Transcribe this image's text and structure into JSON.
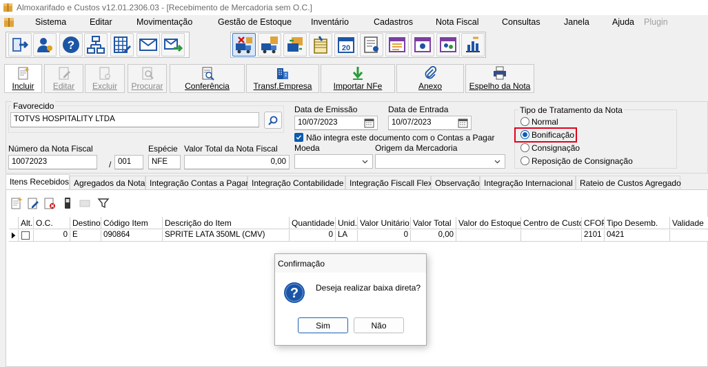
{
  "window": {
    "title": "Almoxarifado e Custos v12.01.2306.03 - [Recebimento de Mercadoria sem O.C.]"
  },
  "menu": [
    "Sistema",
    "Editar",
    "Movimentação",
    "Gestão de Estoque",
    "Inventário",
    "Cadastros",
    "Nota Fiscal",
    "Consultas",
    "Janela",
    "Ajuda",
    "Plugin"
  ],
  "actions": {
    "incluir": "Incluir",
    "editar": "Editar",
    "excluir": "Excluir",
    "procurar": "Procurar",
    "conferencia": "Conferência",
    "transf": "Transf.Empresa",
    "importar": "Importar NFe",
    "anexo": "Anexo",
    "espelho": "Espelho da Nota"
  },
  "form": {
    "favorecido_label": "Favorecido",
    "favorecido_value": "TOTVS HOSPITALITY LTDA",
    "data_emissao_label": "Data de Emissão",
    "data_emissao_value": "10/07/2023",
    "data_entrada_label": "Data de Entrada",
    "data_entrada_value": "10/07/2023",
    "nao_integra_label": "Não integra este documento com o Contas a Pagar",
    "numero_nf_label": "Número da Nota Fiscal",
    "numero_nf_value": "10072023",
    "serie_sep": "/",
    "serie_value": "001",
    "especie_label": "Espécie",
    "especie_value": "NFE",
    "valor_total_label": "Valor Total da Nota Fiscal",
    "valor_total_value": "0,00",
    "moeda_label": "Moeda",
    "moeda_value": "",
    "origem_label": "Origem da Mercadoria",
    "origem_value": "",
    "tratamento_label": "Tipo de Tratamento da Nota",
    "tratamento_options": [
      "Normal",
      "Bonificação",
      "Consignação",
      "Reposição de Consignação"
    ],
    "tratamento_selected": "Bonificação"
  },
  "tabs": [
    "Itens Recebidos",
    "Agregados da Nota",
    "Integração Contas a Pagar",
    "Integração Contabilidade",
    "Integração Fiscall Flex",
    "Observação",
    "Integração Internacional",
    "Rateio de Custos Agregado"
  ],
  "grid": {
    "headers": [
      "Alt.",
      "O.C.",
      "Destino",
      "Código Item",
      "Descrição do Item",
      "Quantidade",
      "Unid.",
      "Valor Unitário",
      "Valor Total",
      "Valor do Estoque",
      "Centro de Custo",
      "CFOP",
      "Tipo Desemb.",
      "Validade"
    ],
    "rows": [
      {
        "alt": "",
        "oc": "0",
        "destino": "E",
        "codigo": "090864",
        "descricao": "SPRITE LATA 350ML (CMV)",
        "quantidade": "0",
        "unid": "LA",
        "valor_unitario": "0",
        "valor_total": "0,00",
        "valor_estoque": "",
        "centro_custo": "",
        "cfop": "2101",
        "tipo_desemb": "0421",
        "validade": ""
      }
    ]
  },
  "dialog": {
    "title": "Confirmação",
    "message": "Deseja realizar baixa direta?",
    "yes": "Sim",
    "no": "Não"
  },
  "colors": {
    "highlight_border": "#e0001a",
    "accent": "#0a5fb8"
  }
}
